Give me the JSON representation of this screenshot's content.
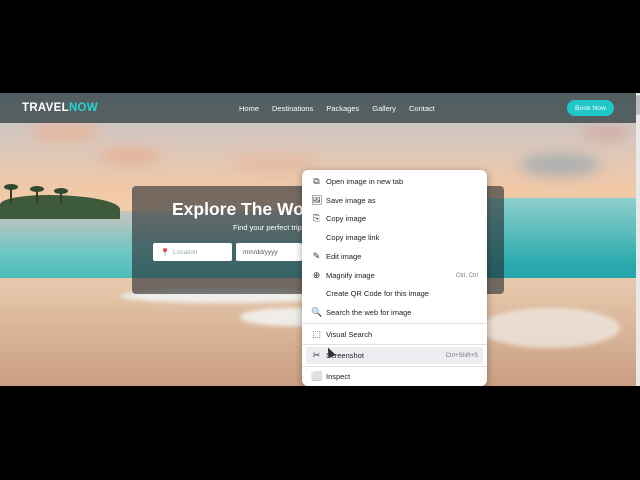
{
  "navbar": {
    "brand_part1": "TRAVEL",
    "brand_part2": "NOW",
    "links": [
      "Home",
      "Destinations",
      "Packages",
      "Gallery",
      "Contact"
    ],
    "cta": "Book Now",
    "accent_color": "#1fc7c7"
  },
  "hero": {
    "title": "Explore The Wo",
    "subtitle": "Find your perfect trip",
    "location_placeholder": "Location",
    "date_placeholder": "mm/dd/yyyy"
  },
  "context_menu": {
    "items": [
      {
        "label": "Open image in new tab",
        "icon": "new-tab-icon",
        "shortcut": ""
      },
      {
        "label": "Save image as",
        "icon": "save-image-icon",
        "shortcut": ""
      },
      {
        "label": "Copy image",
        "icon": "copy-image-icon",
        "shortcut": ""
      },
      {
        "label": "Copy image link",
        "icon": "",
        "shortcut": ""
      },
      {
        "label": "Edit image",
        "icon": "edit-image-icon",
        "shortcut": ""
      },
      {
        "label": "Magnify image",
        "icon": "magnify-icon",
        "shortcut": "Ctrl, Ctrl"
      },
      {
        "label": "Create QR Code for this image",
        "icon": "",
        "shortcut": ""
      },
      {
        "label": "Search the web for image",
        "icon": "image-search-icon",
        "shortcut": ""
      },
      {
        "label": "Visual Search",
        "icon": "visual-search-icon",
        "shortcut": ""
      },
      {
        "label": "Screenshot",
        "icon": "screenshot-icon",
        "shortcut": "Ctrl+Shift+S"
      },
      {
        "label": "Inspect",
        "icon": "inspect-icon",
        "shortcut": ""
      }
    ]
  }
}
